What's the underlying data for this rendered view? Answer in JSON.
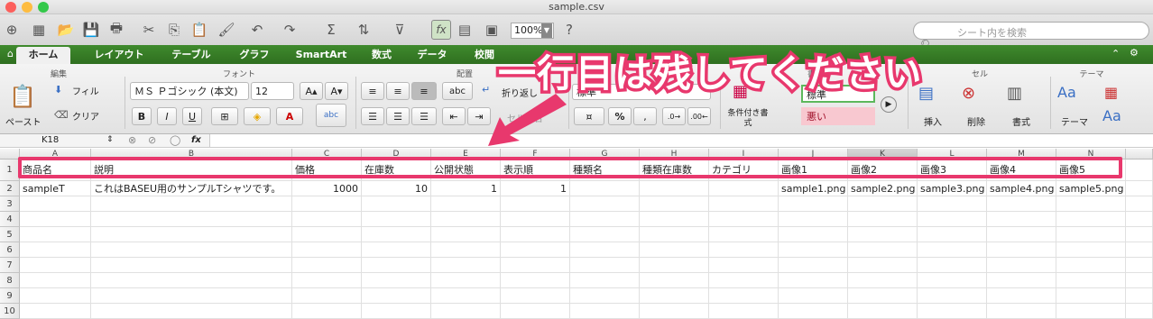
{
  "window": {
    "title": "sample.csv"
  },
  "toolbar": {
    "zoom": "100%",
    "search_placeholder": "シート内を検索"
  },
  "tabs": [
    "ホーム",
    "レイアウト",
    "テーブル",
    "グラフ",
    "SmartArt",
    "数式",
    "データ",
    "校閲"
  ],
  "ribbon": {
    "groups": {
      "edit": "編集",
      "font": "フォント",
      "align": "配置",
      "style": "書式",
      "cell": "セル",
      "theme": "テーマ"
    },
    "paste": "ペースト",
    "fill": "フィル",
    "clear": "クリア",
    "font_name": "ＭＳ Ｐゴシック (本文)",
    "font_size": "12",
    "bold": "B",
    "italic": "I",
    "underline": "U",
    "wrap": "折り返し",
    "merge": "セル結合",
    "number_format": "標準",
    "conditional": "条件付き書式",
    "style_normal": "標準",
    "style_bad": "悪い",
    "insert": "挿入",
    "delete": "削除",
    "format": "書式",
    "theme": "テーマ",
    "abc": "abc"
  },
  "formula_bar": {
    "cell_ref": "K18",
    "fx": "fx",
    "value": ""
  },
  "columns": [
    "A",
    "B",
    "C",
    "D",
    "E",
    "F",
    "G",
    "H",
    "I",
    "J",
    "K",
    "L",
    "M",
    "N"
  ],
  "rows": [
    [
      "商品名",
      "説明",
      "価格",
      "在庫数",
      "公開状態",
      "表示順",
      "種類名",
      "種類在庫数",
      "カテゴリ",
      "画像1",
      "画像2",
      "画像3",
      "画像4",
      "画像5"
    ],
    [
      "sampleT",
      "これはBASEU用のサンプルTシャツです。",
      "1000",
      "10",
      "1",
      "1",
      "",
      "",
      "",
      "sample1.png",
      "sample2.png",
      "sample3.png",
      "sample4.png",
      "sample5.png"
    ]
  ],
  "row_numbers": [
    "1",
    "2",
    "3",
    "4",
    "5",
    "6",
    "7",
    "8",
    "9",
    "10"
  ],
  "annotation": {
    "text": "一行目は残してください",
    "color": "#e8386d"
  }
}
